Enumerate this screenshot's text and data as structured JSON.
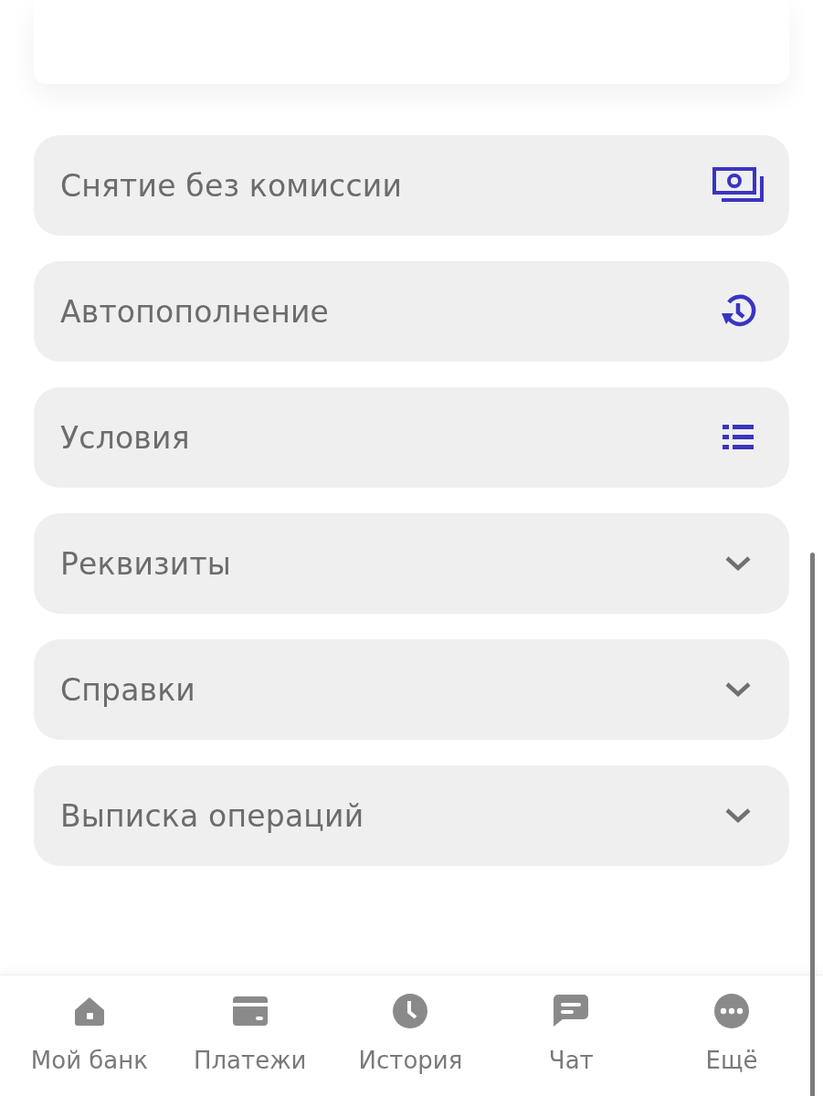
{
  "items": [
    {
      "label": "Снятие без комиссии",
      "kind": "withdrawal"
    },
    {
      "label": "Автопополнение",
      "kind": "autotopup"
    },
    {
      "label": "Условия",
      "kind": "conditions"
    },
    {
      "label": "Реквизиты",
      "kind": "expandable",
      "expanded": false
    },
    {
      "label": "Справки",
      "kind": "expandable",
      "expanded": false
    },
    {
      "label": "Выписка операций",
      "kind": "expandable",
      "expanded": false
    }
  ],
  "bottom_nav": [
    {
      "label": "Мой банк",
      "kind": "home"
    },
    {
      "label": "Платежи",
      "kind": "payments"
    },
    {
      "label": "История",
      "kind": "history"
    },
    {
      "label": "Чат",
      "kind": "chat"
    },
    {
      "label": "Ещё",
      "kind": "more"
    }
  ]
}
